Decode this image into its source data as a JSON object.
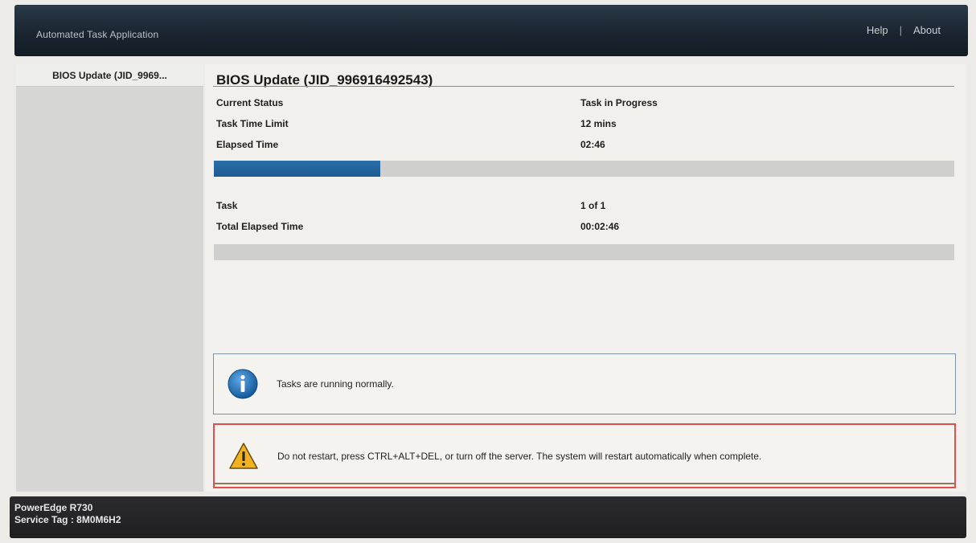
{
  "header": {
    "app_title": "Automated Task Application",
    "help_label": "Help",
    "separator": "|",
    "about_label": "About"
  },
  "sidebar": {
    "items": [
      {
        "label": "BIOS Update (JID_9969..."
      }
    ]
  },
  "main": {
    "title": "BIOS Update (JID_996916492543)",
    "status_rows": [
      {
        "label": "Current Status",
        "value": "Task in Progress"
      },
      {
        "label": "Task Time Limit",
        "value": "12 mins"
      },
      {
        "label": "Elapsed Time",
        "value": "02:46"
      }
    ],
    "progress_fraction": 0.225,
    "overall_rows": [
      {
        "label": "Task",
        "value": "1 of 1"
      },
      {
        "label": "Total Elapsed Time",
        "value": "00:02:46"
      }
    ],
    "overall_progress_fraction": 0,
    "info_message": "Tasks are running normally.",
    "warning_message": "Do not restart, press CTRL+ALT+DEL, or turn off the server.  The system will restart automatically when complete."
  },
  "footer": {
    "model": "PowerEdge R730",
    "service_tag": "Service Tag : 8M0M6H2"
  },
  "icons": {
    "info": "info-icon",
    "warning": "warning-icon"
  },
  "colors": {
    "accent_blue": "#1d5a92",
    "warning_border": "#e24d4d"
  }
}
